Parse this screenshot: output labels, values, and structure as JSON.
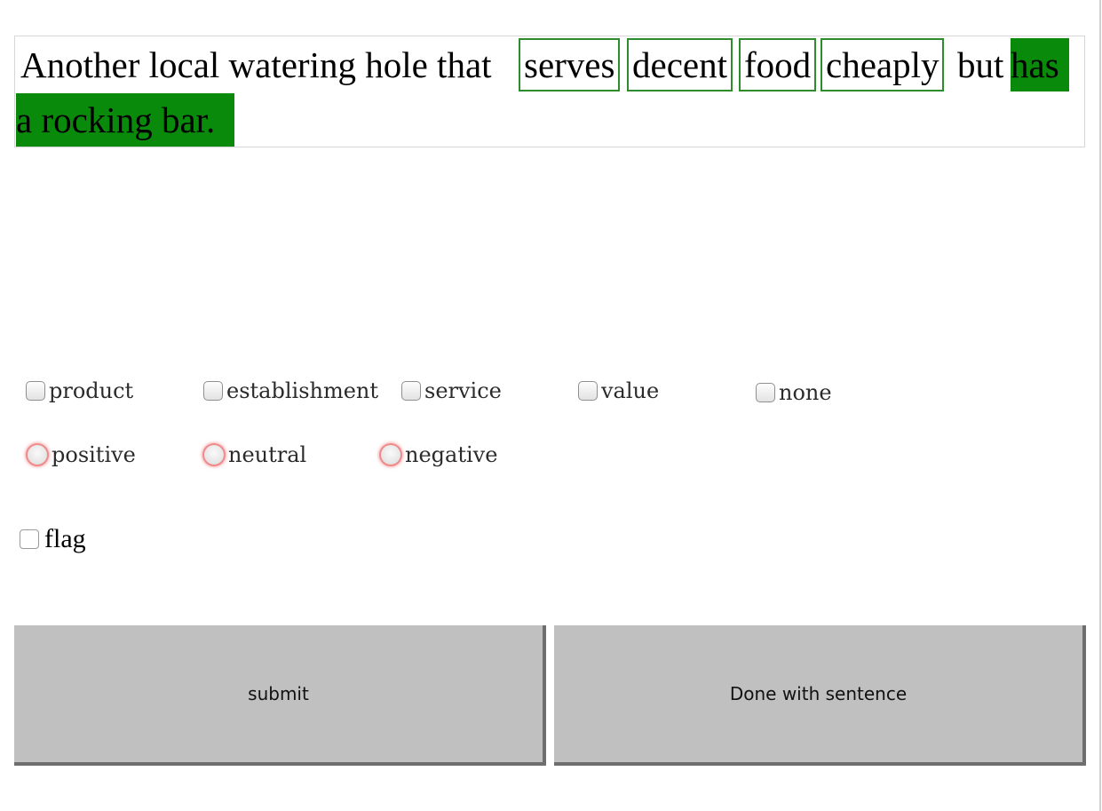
{
  "sentence": {
    "tokens": [
      {
        "text": "Another local watering hole that",
        "style": "plain"
      },
      {
        "text": "serves",
        "style": "boxed"
      },
      {
        "text": "decent",
        "style": "boxed"
      },
      {
        "text": "food",
        "style": "boxed"
      },
      {
        "text": "cheaply",
        "style": "boxed"
      },
      {
        "text": "but",
        "style": "plain"
      },
      {
        "text": "has",
        "style": "filled"
      },
      {
        "text": "a rocking bar.",
        "style": "filled"
      }
    ]
  },
  "aspects": {
    "options": [
      {
        "label": "product",
        "checked": false
      },
      {
        "label": "establishment",
        "checked": false
      },
      {
        "label": "service",
        "checked": false
      },
      {
        "label": "value",
        "checked": false
      },
      {
        "label": "none",
        "checked": false
      }
    ]
  },
  "sentiment": {
    "options": [
      {
        "label": "positive",
        "selected": false
      },
      {
        "label": "neutral",
        "selected": false
      },
      {
        "label": "negative",
        "selected": false
      }
    ]
  },
  "flag": {
    "label": "flag",
    "checked": false
  },
  "buttons": {
    "submit_label": "submit",
    "done_label": "Done with sentence"
  },
  "colors": {
    "highlight_green": "#0a8a0a",
    "box_green": "#2e8b2e",
    "button_gray": "#c0c0c0",
    "radio_ring": "#f08a8a"
  }
}
